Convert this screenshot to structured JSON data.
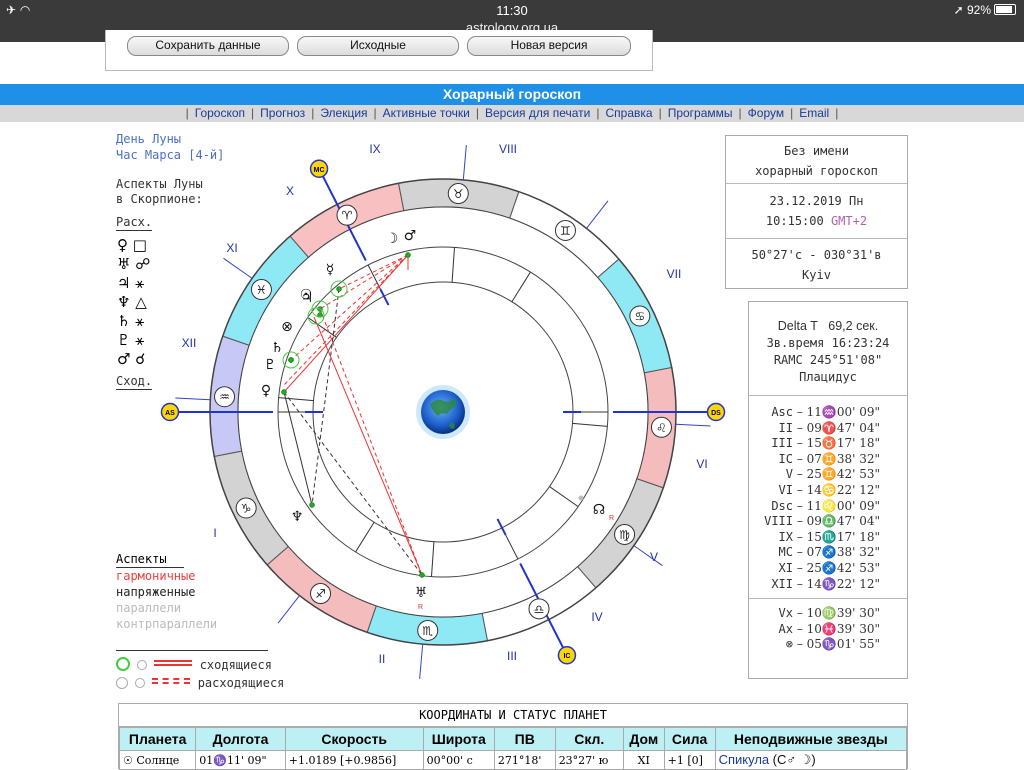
{
  "status": {
    "time": "11:30",
    "url": "astrology.org.ua",
    "battery": "92%"
  },
  "topbuttons": {
    "save": "Сохранить данные",
    "source": "Исходные",
    "newver": "Новая версия"
  },
  "title": "Хорарный гороскоп",
  "nav": [
    "Гороскоп",
    "Прогноз",
    "Элекция",
    "Активные точки",
    "Версия для печати",
    "Справка",
    "Программы",
    "Форум",
    "Email"
  ],
  "moon": {
    "day": "День Луны",
    "hour": "Час Марса [4-й]",
    "aspects_l1": "Аспекты Луны",
    "aspects_l2": "в Скорпионе:",
    "sep_label": "Расх.",
    "app_label": "Сход."
  },
  "moon_aspects": [
    {
      "planet": "♀",
      "aspect": "□"
    },
    {
      "planet": "♅",
      "aspect": "☍"
    },
    {
      "planet": "♃",
      "aspect": "⚹"
    },
    {
      "planet": "♆",
      "aspect": "△"
    },
    {
      "planet": "♄",
      "aspect": "⚹"
    },
    {
      "planet": "♇",
      "aspect": "⚹"
    },
    {
      "planet": "♂",
      "aspect": "☌"
    }
  ],
  "legend": {
    "title": "Аспекты",
    "harm": "гармоничные",
    "tense": "напряженные",
    "par": "параллели",
    "contr": "контрпараллели",
    "applying": "сходящиеся",
    "separating": "расходящиеся"
  },
  "legend_colors": {
    "harm": "#e84040",
    "tense": "#222222",
    "par": "#bbbbbb",
    "contr": "#bbbbbb"
  },
  "chart": {
    "houses": [
      "I",
      "II",
      "III",
      "IV",
      "V",
      "VI",
      "VII",
      "VIII",
      "IX",
      "X",
      "XI",
      "XII"
    ],
    "angles": {
      "asc": "AS",
      "dsc": "DS",
      "mc": "MC",
      "ic": "IC"
    }
  },
  "info1": {
    "name": "Без имени",
    "type": "хорарный гороскоп",
    "date": "23.12.2019 Пн",
    "time": "10:15:00",
    "tz": "GMT+2",
    "coords": "50°27'с - 030°31'в",
    "city": "Kyiv"
  },
  "info2": {
    "deltat_label": "Delta T",
    "deltat_val": "69,2 сек.",
    "sidereal": "Зв.время 16:23:24",
    "ramc": "RAMC 245°51'08\"",
    "system": "Плацидус"
  },
  "cusps": [
    {
      "label": "Asc",
      "value": "11♒00' 09\""
    },
    {
      "label": "II",
      "value": "09♈47' 04\""
    },
    {
      "label": "III",
      "value": "15♉17' 18\""
    },
    {
      "label": "IC",
      "value": "07♊38' 32\""
    },
    {
      "label": "V",
      "value": "25♊42' 53\""
    },
    {
      "label": "VI",
      "value": "14♋22' 12\""
    },
    {
      "label": "Dsc",
      "value": "11♌00' 09\""
    },
    {
      "label": "VIII",
      "value": "09♎47' 04\""
    },
    {
      "label": "IX",
      "value": "15♏17' 18\""
    },
    {
      "label": "MC",
      "value": "07♐38' 32\""
    },
    {
      "label": "XI",
      "value": "25♐42' 53\""
    },
    {
      "label": "XII",
      "value": "14♑22' 12\""
    }
  ],
  "points": [
    {
      "label": "Vx",
      "value": "10♍39' 30\""
    },
    {
      "label": "Ax",
      "value": "10♓39' 30\""
    },
    {
      "label": "⊗",
      "value": "05♑01' 55\""
    }
  ],
  "table": {
    "title": "КООРДИНАТЫ И СТАТУС ПЛАНЕТ",
    "headers": [
      "Планета",
      "Долгота",
      "Скорость",
      "Широта",
      "ПВ",
      "Скл.",
      "Дом",
      "Сила",
      "Неподвижные звезды"
    ],
    "row": {
      "planet": "☉ Солнце",
      "lon": "01♑11' 09\"",
      "speed": "+1.0189  [+0.9856]",
      "lat": "00°00' с",
      "ra": "271°18'",
      "decl": "23°27' ю",
      "house": "XI",
      "power": "+1   [0]",
      "star": "Спикула",
      "star_extra": "(С♂ ☽)"
    }
  }
}
